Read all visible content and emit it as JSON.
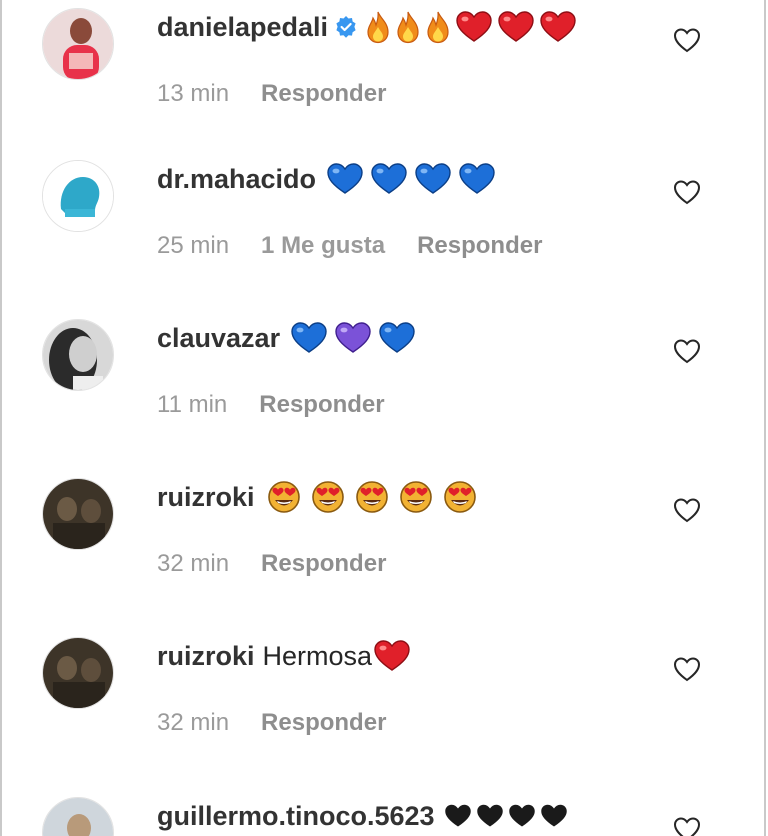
{
  "colors": {
    "username": "#262626",
    "meta": "#8e8e8e",
    "verified": "#3897f0",
    "fire": "#f5a623",
    "red_heart": "#e0202a",
    "blue_heart": "#1d6fd8",
    "purple_heart": "#7b52d8",
    "black_heart": "#1a1a1a",
    "heart_eyes": "#f2b233"
  },
  "comments": [
    {
      "username": "danielapedali",
      "verified": true,
      "text": "",
      "emojis": [
        "fire",
        "fire",
        "fire",
        "red-heart",
        "red-heart",
        "red-heart"
      ],
      "time": "13 min",
      "likes": "",
      "reply_label": "Responder",
      "avatar": "pink-portrait"
    },
    {
      "username": "dr.mahacido",
      "verified": false,
      "text": "",
      "emojis": [
        "blue-heart",
        "blue-heart",
        "blue-heart",
        "blue-heart"
      ],
      "time": "25 min",
      "likes": "1 Me gusta",
      "reply_label": "Responder",
      "avatar": "blue-silhouette"
    },
    {
      "username": "clauvazar",
      "verified": false,
      "text": "",
      "emojis": [
        "blue-heart",
        "purple-heart",
        "blue-heart"
      ],
      "time": "11 min",
      "likes": "",
      "reply_label": "Responder",
      "avatar": "grayscale-portrait"
    },
    {
      "username": "ruizroki",
      "verified": false,
      "text": "",
      "emojis": [
        "heart-eyes",
        "heart-eyes",
        "heart-eyes",
        "heart-eyes",
        "heart-eyes"
      ],
      "time": "32 min",
      "likes": "",
      "reply_label": "Responder",
      "avatar": "dark-photo"
    },
    {
      "username": "ruizroki",
      "verified": false,
      "text": "Hermosa",
      "emojis": [
        "red-heart"
      ],
      "time": "32 min",
      "likes": "",
      "reply_label": "Responder",
      "avatar": "dark-photo"
    },
    {
      "username": "guillermo.tinoco.5623",
      "verified": false,
      "text": "",
      "emojis": [
        "black-heart",
        "black-heart",
        "black-heart",
        "black-heart"
      ],
      "time": "",
      "likes": "",
      "reply_label": "",
      "avatar": "outdoor-photo"
    }
  ],
  "icons": {
    "like": "heart-outline-icon"
  }
}
